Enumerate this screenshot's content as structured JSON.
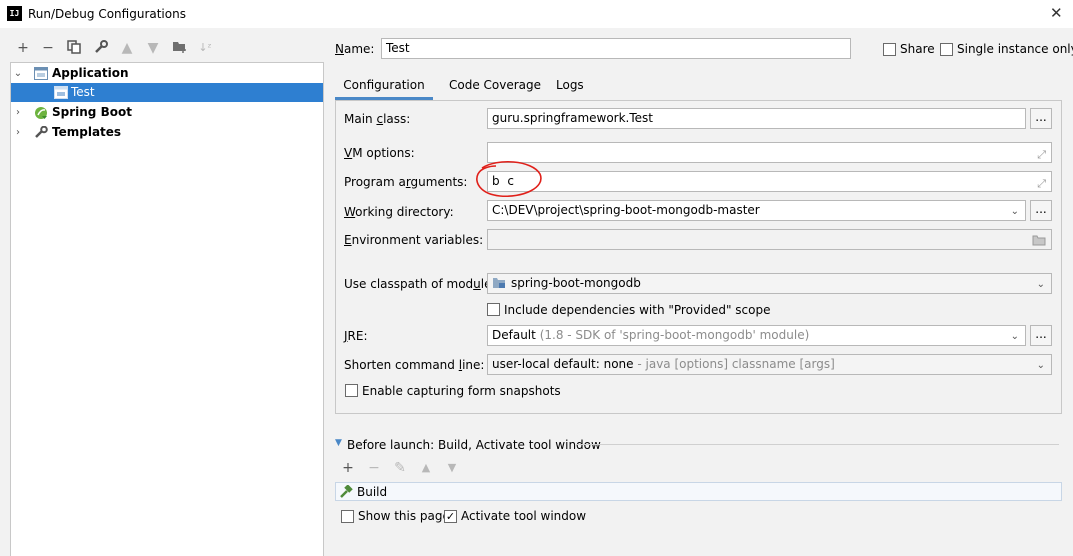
{
  "window": {
    "title": "Run/Debug Configurations",
    "app_icon": "IJ"
  },
  "tree": {
    "items": [
      {
        "label": "Application",
        "bold": true,
        "expanded": true,
        "icon": "application-icon"
      },
      {
        "label": "Test",
        "bold": false,
        "selected": true,
        "icon": "run-config-icon"
      },
      {
        "label": "Spring Boot",
        "bold": true,
        "expanded": false,
        "icon": "spring-boot-icon"
      },
      {
        "label": "Templates",
        "bold": true,
        "expanded": false,
        "icon": "wrench-icon"
      }
    ]
  },
  "header": {
    "name_label": "Name:",
    "name_value": "Test",
    "share_label": "Share",
    "share_checked": false,
    "single_instance_label": "Single instance only",
    "single_instance_checked": false
  },
  "tabs": [
    "Configuration",
    "Code Coverage",
    "Logs"
  ],
  "form": {
    "main_class_label": "Main class:",
    "main_class_value": "guru.springframework.Test",
    "vm_options_label": "VM options:",
    "vm_options_value": "",
    "program_args_label": "Program arguments:",
    "program_args_value": "b c",
    "working_dir_label": "Working directory:",
    "working_dir_value": "C:\\DEV\\project\\spring-boot-mongodb-master",
    "env_vars_label": "Environment variables:",
    "env_vars_value": "",
    "classpath_label": "Use classpath of module:",
    "classpath_value": "spring-boot-mongodb",
    "include_deps_label": "Include dependencies with \"Provided\" scope",
    "include_deps_checked": false,
    "jre_label": "JRE:",
    "jre_value": "Default",
    "jre_hint": "(1.8 - SDK of 'spring-boot-mongodb' module)",
    "shorten_label": "Shorten command line:",
    "shorten_value": "user-local default: none",
    "shorten_hint": "- java [options] classname [args]",
    "capture_label": "Enable capturing form snapshots",
    "capture_checked": false,
    "dots": "..."
  },
  "before_launch": {
    "title": "Before launch: Build, Activate tool window",
    "items": [
      "Build"
    ],
    "show_page_label": "Show this page",
    "show_page_checked": false,
    "activate_label": "Activate tool window",
    "activate_checked": true
  },
  "colors": {
    "selection": "#2e7fd1",
    "annotation": "#e0201a",
    "tab_underline": "#4a88c7"
  }
}
